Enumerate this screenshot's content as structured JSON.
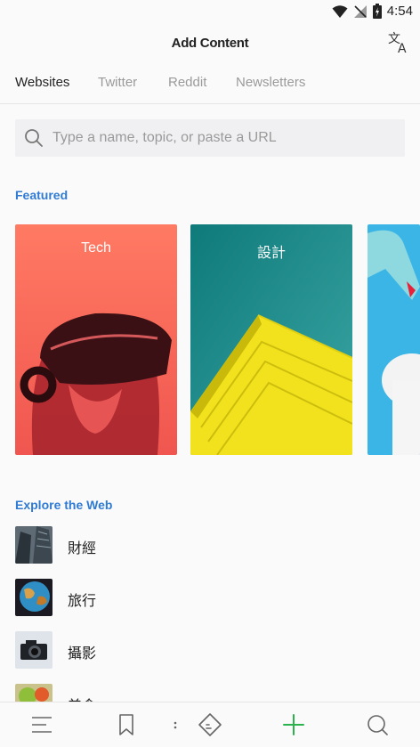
{
  "status_bar": {
    "time": "4:54"
  },
  "header": {
    "title": "Add Content",
    "translate_icon": "translate-icon"
  },
  "tabs": [
    {
      "label": "Websites",
      "active": true
    },
    {
      "label": "Twitter",
      "active": false
    },
    {
      "label": "Reddit",
      "active": false
    },
    {
      "label": "Newsletters",
      "active": false
    }
  ],
  "search": {
    "placeholder": "Type a name, topic, or paste a URL",
    "value": ""
  },
  "featured": {
    "title": "Featured",
    "cards": [
      {
        "label": "Tech"
      },
      {
        "label": "設計"
      },
      {
        "label": ""
      }
    ]
  },
  "explore": {
    "title": "Explore the Web",
    "items": [
      {
        "label": "財經"
      },
      {
        "label": "旅行"
      },
      {
        "label": "攝影"
      },
      {
        "label": "美食"
      }
    ]
  },
  "bottom_nav": [
    "menu-icon",
    "bookmark-icon",
    "feedly-icon",
    "add-icon",
    "search-icon"
  ],
  "colors": {
    "accent": "#2f7bd4",
    "add_green": "#2bb24c"
  }
}
